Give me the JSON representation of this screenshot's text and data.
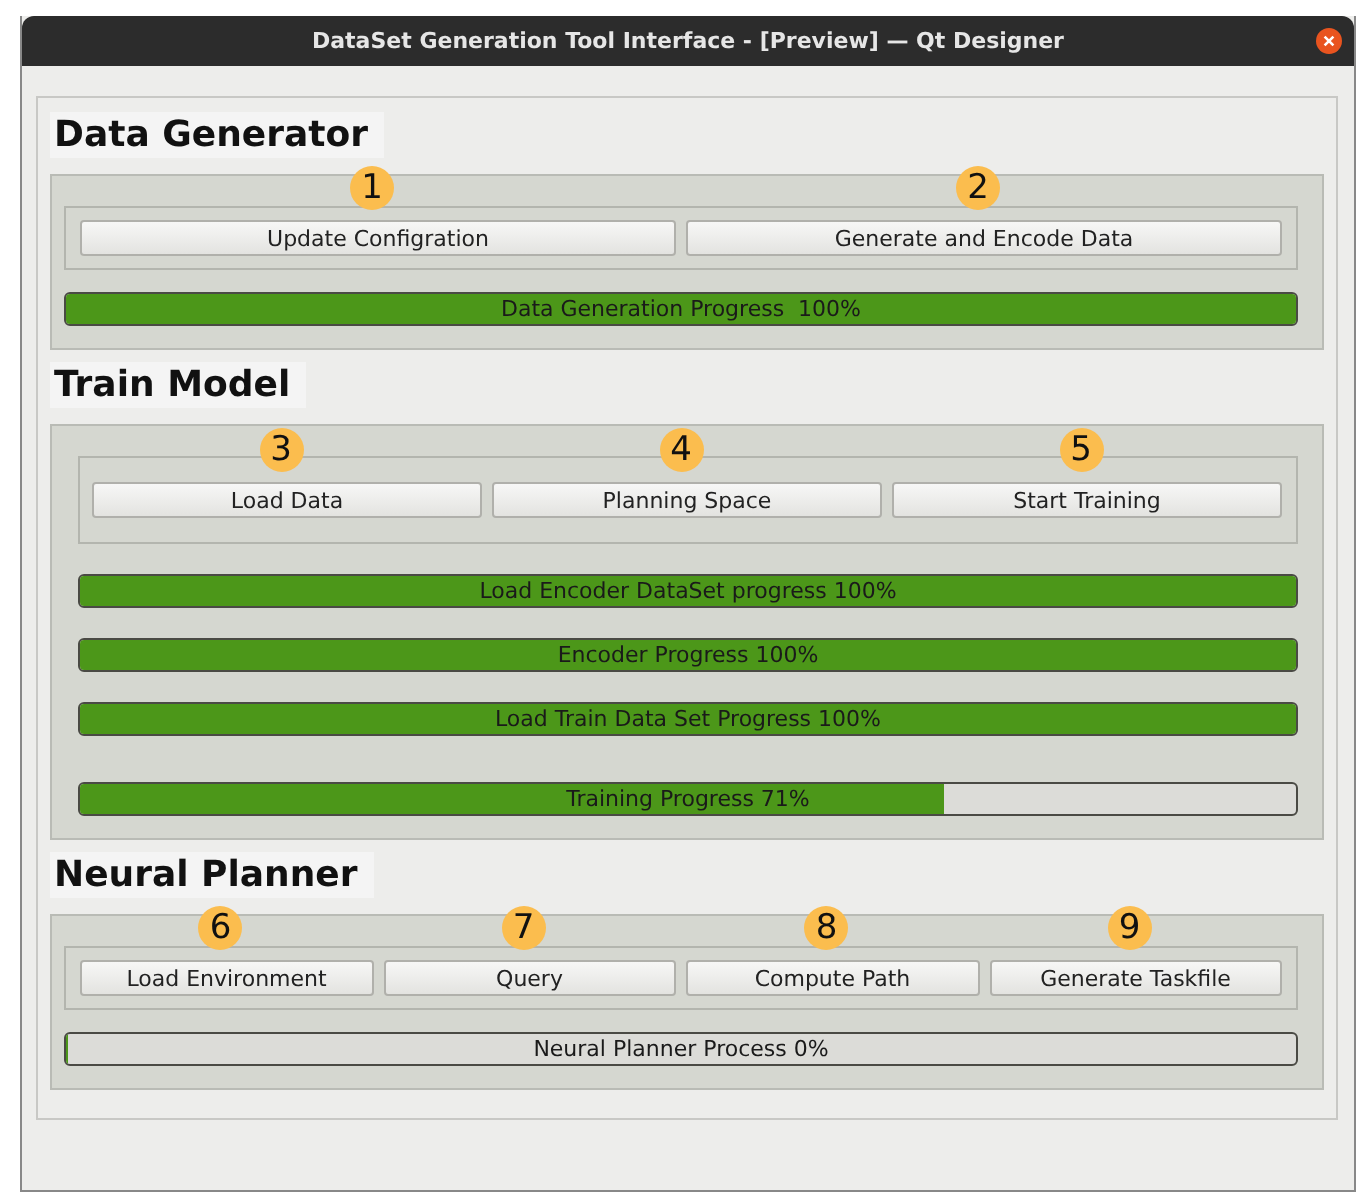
{
  "window": {
    "title": "DataSet Generation Tool Interface - [Preview] — Qt Designer"
  },
  "sections": [
    {
      "title": "Data Generator",
      "buttons": [
        {
          "label": "Update Configration",
          "marker": "1"
        },
        {
          "label": "Generate and Encode Data",
          "marker": "2"
        }
      ],
      "progress": [
        {
          "label": "Data Generation Progress  100%",
          "level": 1
        }
      ]
    },
    {
      "title": "Train Model",
      "buttons": [
        {
          "label": "Load Data",
          "marker": "3"
        },
        {
          "label": "Planning Space",
          "marker": "4"
        },
        {
          "label": "Start Training",
          "marker": "5"
        }
      ],
      "progress": [
        {
          "label": "Load Encoder DataSet progress 100%",
          "level": 1
        },
        {
          "label": "Encoder Progress 100%",
          "level": 1
        },
        {
          "label": "Load Train Data Set Progress 100%",
          "level": 1
        },
        {
          "label": "Training Progress 71%",
          "level": 0.71
        }
      ]
    },
    {
      "title": "Neural Planner",
      "buttons": [
        {
          "label": "Load Environment",
          "marker": "6"
        },
        {
          "label": "Query",
          "marker": "7"
        },
        {
          "label": "Compute Path",
          "marker": "8"
        },
        {
          "label": "Generate Taskfile",
          "marker": "9"
        }
      ],
      "progress": [
        {
          "label": "Neural Planner Process 0%",
          "level": 0
        }
      ]
    }
  ]
}
